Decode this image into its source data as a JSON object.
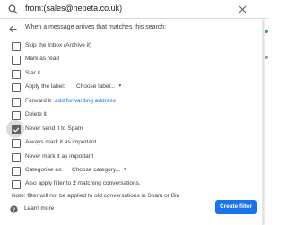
{
  "search": {
    "query": "from:(sales@nepeta.co.uk)"
  },
  "panel": {
    "header": "When a message arrives that matches this search:",
    "options": [
      {
        "label": "Skip the Inbox (Archive it)",
        "checked": false
      },
      {
        "label": "Mark as read",
        "checked": false
      },
      {
        "label": "Star it",
        "checked": false
      },
      {
        "label": "Apply the label:",
        "checked": false,
        "select": "Choose label..."
      },
      {
        "label": "Forward it",
        "checked": false,
        "link": "add forwarding address"
      },
      {
        "label": "Delete it",
        "checked": false
      },
      {
        "label": "Never send it to Spam",
        "checked": true
      },
      {
        "label": "Always mark it as important",
        "checked": false
      },
      {
        "label": "Never mark it as important",
        "checked": false
      },
      {
        "label": "Categorise as:",
        "checked": false,
        "select": "Choose category..."
      }
    ],
    "also_apply": {
      "prefix": "Also apply filter to ",
      "count": "2",
      "suffix": " matching conversations.",
      "checked": false
    },
    "note": "Note: filter will not be applied to old conversations in Spam or Bin",
    "learn_more": "Learn more",
    "create_button": "Create filter"
  },
  "colors": {
    "primary": "#1a73e8",
    "checkbox": "#5f6368",
    "text": "#3c4043"
  }
}
